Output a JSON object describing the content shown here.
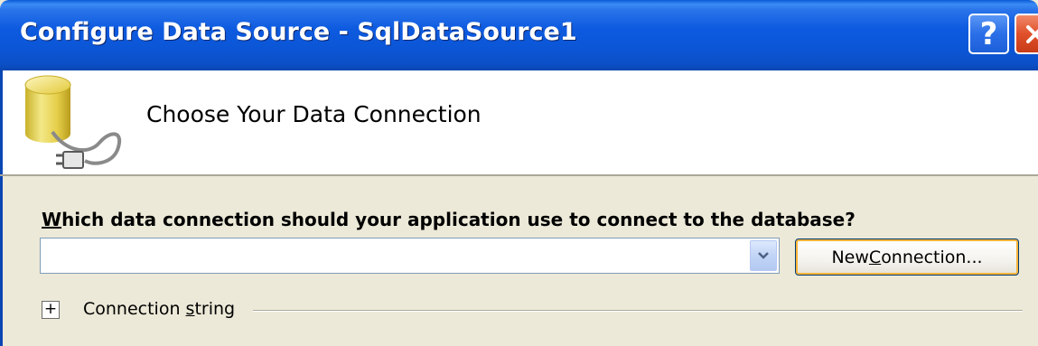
{
  "window": {
    "title": "Configure Data Source - SqlDataSource1",
    "help_label": "?",
    "colors": {
      "titlebar": "#0b55d6",
      "close": "#e0502a",
      "body": "#ece9d8"
    }
  },
  "header": {
    "icon": "database-plug-icon",
    "title": "Choose Your Data Connection"
  },
  "main": {
    "question_accel": "W",
    "question_rest": "hich data connection should your application use to connect to the database?",
    "connection_select": {
      "value": ""
    },
    "new_connection": {
      "before": "New ",
      "accel": "C",
      "after": "onnection..."
    },
    "connection_string": {
      "expander": "+",
      "before": "Connection ",
      "accel": "s",
      "after": "tring"
    }
  }
}
